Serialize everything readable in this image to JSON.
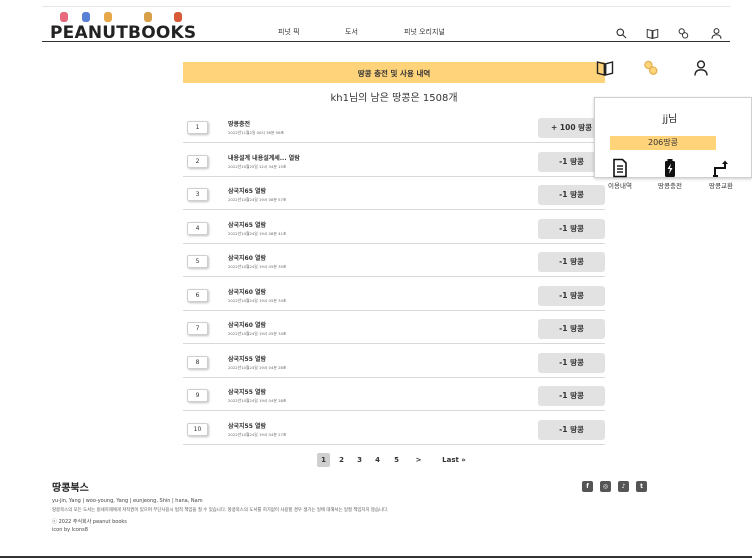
{
  "header": {
    "logo": "PEANUTBOOKS",
    "nav": [
      "피넛 픽",
      "도서",
      "피넛 오리지널"
    ],
    "icons": [
      "search-icon",
      "book-icon",
      "peanut-icon",
      "user-icon"
    ]
  },
  "main": {
    "section_title": "땅콩 충전 및 사용 내역",
    "remaining_text": "kh1님의 남은 땅콩은 1508개",
    "rows": [
      {
        "num": "1",
        "title": "땅콩충전",
        "date": "2022년11월2일 00시 36분 56초",
        "amount": "+ 100 땅콩"
      },
      {
        "num": "2",
        "title": "내용설계 내용설계세... 열람",
        "date": "2022년10월25일 12시 34분 15초",
        "amount": "-1 땅콩"
      },
      {
        "num": "3",
        "title": "삼국지65 열람",
        "date": "2022년10월24일 19시 08분 57초",
        "amount": "-1 땅콩"
      },
      {
        "num": "4",
        "title": "삼국지65 열람",
        "date": "2022년10월24일 19시 08분 41초",
        "amount": "-1 땅콩"
      },
      {
        "num": "5",
        "title": "삼국지60 열람",
        "date": "2022년10월24일 19시 05분 35초",
        "amount": "-1 땅콩"
      },
      {
        "num": "6",
        "title": "삼국지60 열람",
        "date": "2022년10월24일 19시 05분 34초",
        "amount": "-1 땅콩"
      },
      {
        "num": "7",
        "title": "삼국지60 열람",
        "date": "2022년10월24일 19시 05분 34초",
        "amount": "-1 땅콩"
      },
      {
        "num": "8",
        "title": "삼국지55 열람",
        "date": "2022년10월24일 19시 04분 28초",
        "amount": "-1 땅콩"
      },
      {
        "num": "9",
        "title": "삼국지55 열람",
        "date": "2022년10월24일 19시 04분 28초",
        "amount": "-1 땅콩"
      },
      {
        "num": "10",
        "title": "삼국지55 열람",
        "date": "2022년10월24일 19시 04분 27초",
        "amount": "-1 땅콩"
      }
    ],
    "pagination": {
      "pages": [
        "1",
        "2",
        "3",
        "4",
        "5"
      ],
      "current": "1",
      "next": ">",
      "last": "Last »"
    }
  },
  "popup": {
    "username": "jj님",
    "balance": "206땅콩",
    "actions": [
      {
        "label": "이용내역",
        "icon": "document-icon"
      },
      {
        "label": "땅콩충전",
        "icon": "battery-charge-icon"
      },
      {
        "label": "땅콩교환",
        "icon": "exchange-arrow-icon"
      }
    ]
  },
  "footer": {
    "brand": "땅콩북스",
    "credits": "yu-jin, Yang  |  woo-young, Yang  |  eunjeong, Shin  |  hana, Nam",
    "notice": "땅콩북스의 모든 도서는 읽세지제에게 저작권이 있으며 무단사용시 법적 책임을 질 수 있습니다. 땅콩북스의 도서를 허가없이 사용할 경우 생기는 일에 대해서는 일절 책임지지 않습니다.",
    "copyright": "ⓒ 2022 주식회사 peanut books",
    "icon_credit": "icon by Icons8",
    "social": [
      "facebook-icon",
      "instagram-icon",
      "tiktok-icon",
      "twitter-icon"
    ]
  },
  "colors": {
    "accent": "#ffd37a",
    "amount_bg": "#e2e2e2"
  }
}
